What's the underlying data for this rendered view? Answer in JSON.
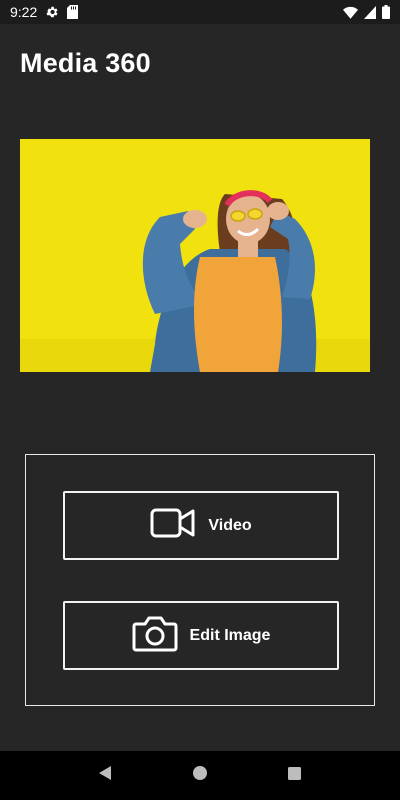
{
  "status_bar": {
    "time": "9:22",
    "icons": [
      "gear-icon",
      "sd-card-icon",
      "wifi-icon",
      "signal-icon",
      "battery-icon"
    ]
  },
  "app": {
    "title": "Media 360"
  },
  "hero_image": {
    "description_icon": "photo-woman-yellow-background"
  },
  "actions": {
    "video_label": "Video",
    "video_icon": "video-camera-icon",
    "edit_label": "Edit Image",
    "edit_icon": "camera-icon"
  },
  "nav": {
    "items": [
      "back-icon",
      "home-icon",
      "recents-icon"
    ]
  },
  "colors": {
    "background": "#262626",
    "hero_background": "#f1e20f",
    "accent_border": "#f2f2f2"
  }
}
